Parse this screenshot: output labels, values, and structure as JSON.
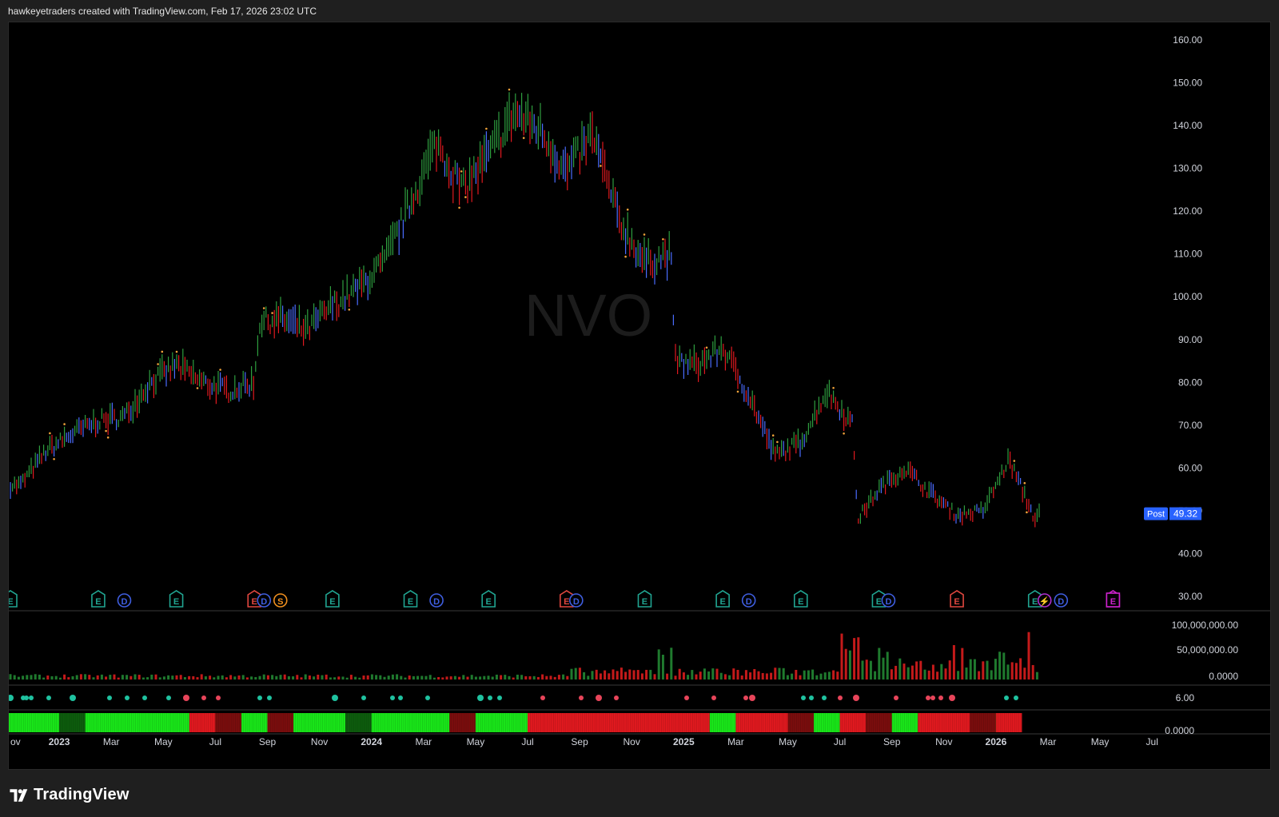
{
  "header": {
    "caption": "hawkeyetraders created with TradingView.com, Feb 17, 2026 23:02 UTC"
  },
  "footer": {
    "brand": "TradingView"
  },
  "colors": {
    "background": "#000000",
    "frame": "#1f1f1f",
    "bar_up": "#2e9e3f",
    "bar_down": "#e0191f",
    "bar_neutral": "#4a6cff",
    "event_earnings": "#21a592",
    "event_earnings_miss": "#e0473f",
    "event_dividend": "#3f5ee0",
    "event_split": "#f0901f",
    "event_upcoming": "#cc22cc",
    "price_label": "#2962ff"
  },
  "chart_data": {
    "type": "ohlc",
    "symbol_watermark": "NVO",
    "price_axis": {
      "ticks": [
        "160.00",
        "150.00",
        "140.00",
        "130.00",
        "120.00",
        "110.00",
        "100.00",
        "90.00",
        "80.00",
        "70.00",
        "60.00",
        "50.00",
        "40.00",
        "30.00"
      ],
      "ylim": [
        30,
        160
      ]
    },
    "current_price": {
      "tag": "Post",
      "value": "49.32"
    },
    "time_axis": {
      "labels": [
        "ov",
        "2023",
        "Mar",
        "May",
        "Jul",
        "Sep",
        "Nov",
        "2024",
        "Mar",
        "May",
        "Jul",
        "Sep",
        "Nov",
        "2025",
        "Mar",
        "May",
        "Jul",
        "Sep",
        "Nov",
        "2026",
        "Mar",
        "May",
        "Jul"
      ],
      "values": [
        "2022-11",
        "2023-01",
        "2023-03",
        "2023-05",
        "2023-07",
        "2023-09",
        "2023-11",
        "2024-01",
        "2024-03",
        "2024-05",
        "2024-07",
        "2024-09",
        "2024-11",
        "2025-01",
        "2025-03",
        "2025-05",
        "2025-07",
        "2025-09",
        "2025-11",
        "2026-01",
        "2026-03",
        "2026-05",
        "2026-07"
      ]
    },
    "price_path": [
      [
        "2022-11",
        56
      ],
      [
        "2022-12",
        64
      ],
      [
        "2023-01",
        68
      ],
      [
        "2023-02",
        71
      ],
      [
        "2023-03",
        72
      ],
      [
        "2023-04",
        80
      ],
      [
        "2023-05",
        84
      ],
      [
        "2023-06",
        80
      ],
      [
        "2023-07",
        78
      ],
      [
        "2023-08",
        80
      ],
      [
        "2023-08",
        94
      ],
      [
        "2023-09",
        95
      ],
      [
        "2023-10",
        92
      ],
      [
        "2023-11",
        98
      ],
      [
        "2023-12",
        102
      ],
      [
        "2024-01",
        108
      ],
      [
        "2024-02",
        122
      ],
      [
        "2024-03",
        136
      ],
      [
        "2024-04",
        125
      ],
      [
        "2024-05",
        133
      ],
      [
        "2024-06",
        143
      ],
      [
        "2024-07",
        139
      ],
      [
        "2024-08",
        129
      ],
      [
        "2024-09",
        138
      ],
      [
        "2024-10",
        118
      ],
      [
        "2024-11",
        108
      ],
      [
        "2024-12",
        110
      ],
      [
        "2024-12",
        85
      ],
      [
        "2025-01",
        84
      ],
      [
        "2025-02",
        88
      ],
      [
        "2025-03",
        77
      ],
      [
        "2025-04",
        63
      ],
      [
        "2025-05",
        66
      ],
      [
        "2025-06",
        78
      ],
      [
        "2025-07",
        70
      ],
      [
        "2025-07",
        48
      ],
      [
        "2025-08",
        55
      ],
      [
        "2025-09",
        60
      ],
      [
        "2025-10",
        54
      ],
      [
        "2025-11",
        49
      ],
      [
        "2025-12",
        50
      ],
      [
        "2026-01",
        62
      ],
      [
        "2026-02",
        48
      ],
      [
        "2026-02",
        49.32
      ]
    ],
    "volume_axis": {
      "ticks": [
        "100,000,000.00",
        "50,000,000.00",
        "0.0000"
      ]
    },
    "indicator_1": {
      "ticks": [
        "6.00"
      ]
    },
    "indicator_2": {
      "ticks": [
        "0.0000"
      ]
    },
    "regime_bands": [
      [
        "2022-11",
        "2023-01",
        "bright-green"
      ],
      [
        "2023-01",
        "2023-02",
        "dark-green"
      ],
      [
        "2023-02",
        "2023-06",
        "bright-green"
      ],
      [
        "2023-06",
        "2023-07",
        "red"
      ],
      [
        "2023-07",
        "2023-08",
        "dark-red"
      ],
      [
        "2023-08",
        "2023-09",
        "bright-green"
      ],
      [
        "2023-09",
        "2023-10",
        "dark-red"
      ],
      [
        "2023-10",
        "2023-12",
        "bright-green"
      ],
      [
        "2023-12",
        "2024-01",
        "dark-green"
      ],
      [
        "2024-01",
        "2024-04",
        "bright-green"
      ],
      [
        "2024-04",
        "2024-05",
        "dark-red"
      ],
      [
        "2024-05",
        "2024-07",
        "bright-green"
      ],
      [
        "2024-07",
        "2024-08",
        "red"
      ],
      [
        "2024-08",
        "2024-08",
        "dark-red"
      ],
      [
        "2024-08",
        "2025-02",
        "red"
      ],
      [
        "2025-02",
        "2025-03",
        "bright-green"
      ],
      [
        "2025-03",
        "2025-05",
        "red"
      ],
      [
        "2025-05",
        "2025-06",
        "dark-red"
      ],
      [
        "2025-06",
        "2025-07",
        "bright-green"
      ],
      [
        "2025-07",
        "2025-07",
        "dark-red"
      ],
      [
        "2025-07",
        "2025-08",
        "red"
      ],
      [
        "2025-08",
        "2025-09",
        "dark-red"
      ],
      [
        "2025-09",
        "2025-10",
        "bright-green"
      ],
      [
        "2025-10",
        "2025-12",
        "red"
      ],
      [
        "2025-12",
        "2026-01",
        "dark-red"
      ],
      [
        "2026-01",
        "2026-01",
        "bright-green"
      ],
      [
        "2026-01",
        "2026-02",
        "red"
      ]
    ],
    "events": [
      {
        "date": "2022-11",
        "label": "E",
        "kind": "earnings"
      },
      {
        "date": "2023-02",
        "label": "E",
        "kind": "earnings"
      },
      {
        "date": "2023-03",
        "label": "D",
        "kind": "dividend"
      },
      {
        "date": "2023-05",
        "label": "E",
        "kind": "earnings"
      },
      {
        "date": "2023-08",
        "label": "E",
        "kind": "earnings_miss"
      },
      {
        "date": "2023-08",
        "label": "D",
        "kind": "dividend"
      },
      {
        "date": "2023-09",
        "label": "S",
        "kind": "split"
      },
      {
        "date": "2023-11",
        "label": "E",
        "kind": "earnings"
      },
      {
        "date": "2024-02",
        "label": "E",
        "kind": "earnings"
      },
      {
        "date": "2024-03",
        "label": "D",
        "kind": "dividend"
      },
      {
        "date": "2024-05",
        "label": "E",
        "kind": "earnings"
      },
      {
        "date": "2024-08",
        "label": "E",
        "kind": "earnings_miss"
      },
      {
        "date": "2024-08",
        "label": "D",
        "kind": "dividend"
      },
      {
        "date": "2024-11",
        "label": "E",
        "kind": "earnings"
      },
      {
        "date": "2025-02",
        "label": "E",
        "kind": "earnings"
      },
      {
        "date": "2025-03",
        "label": "D",
        "kind": "dividend"
      },
      {
        "date": "2025-05",
        "label": "E",
        "kind": "earnings"
      },
      {
        "date": "2025-08",
        "label": "E",
        "kind": "earnings"
      },
      {
        "date": "2025-08",
        "label": "D",
        "kind": "dividend"
      },
      {
        "date": "2025-11",
        "label": "E",
        "kind": "earnings_miss"
      },
      {
        "date": "2026-02",
        "label": "E",
        "kind": "earnings"
      },
      {
        "date": "2026-02",
        "label": "⚡",
        "kind": "upcoming_bolt"
      },
      {
        "date": "2026-03",
        "label": "D",
        "kind": "dividend"
      },
      {
        "date": "2026-05",
        "label": "E",
        "kind": "upcoming"
      }
    ]
  }
}
